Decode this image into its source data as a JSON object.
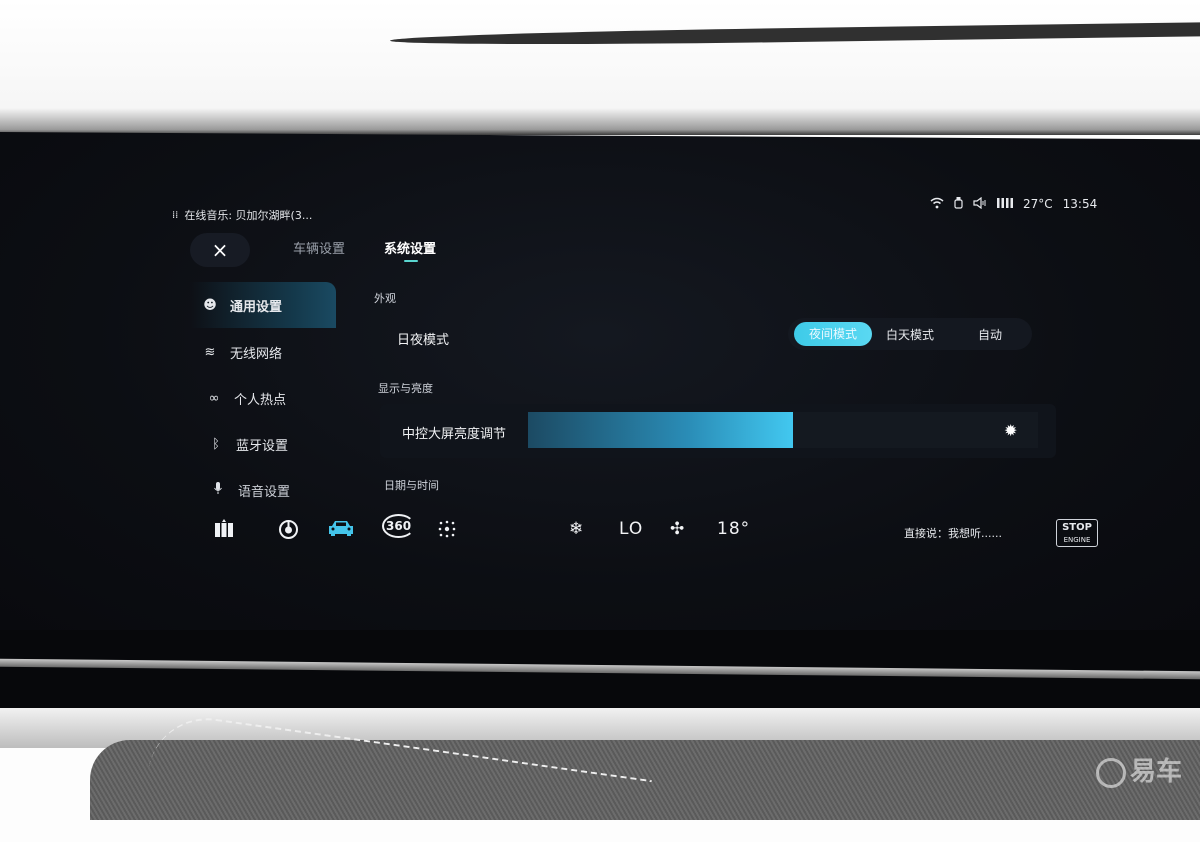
{
  "status_bar": {
    "now_playing": "在线音乐: 贝加尔湖畔(3...",
    "temperature": "27°C",
    "time": "13:54",
    "icons": [
      "music-bars-icon",
      "wifi-icon",
      "usb-icon",
      "volume-icon",
      "signal-icon"
    ]
  },
  "header": {
    "close_icon": "×",
    "tabs": [
      {
        "label": "车辆设置",
        "active": false
      },
      {
        "label": "系统设置",
        "active": true
      }
    ]
  },
  "sidebar": {
    "items": [
      {
        "label": "通用设置",
        "icon": "general-icon",
        "glyph": "☻",
        "active": true
      },
      {
        "label": "无线网络",
        "icon": "wifi-icon",
        "glyph": "≋",
        "active": false
      },
      {
        "label": "个人热点",
        "icon": "link-icon",
        "glyph": "∞",
        "active": false
      },
      {
        "label": "蓝牙设置",
        "icon": "bluetooth-icon",
        "glyph": "ᛒ",
        "active": false
      },
      {
        "label": "语音设置",
        "icon": "microphone-icon",
        "glyph": "🎙",
        "active": false
      }
    ]
  },
  "main": {
    "appearance": {
      "section_label": "外观",
      "day_night": {
        "label": "日夜模式",
        "options": [
          "夜间模式",
          "白天模式",
          "自动"
        ],
        "selected": "夜间模式"
      }
    },
    "display": {
      "section_label": "显示与亮度",
      "brightness": {
        "label": "中控大屏亮度调节",
        "value_percent": 52,
        "icon": "sun-icon"
      }
    },
    "datetime": {
      "section_label": "日期与时间"
    }
  },
  "dock": {
    "apps": [
      {
        "name": "apps-icon",
        "glyph": "▥"
      },
      {
        "name": "power-timer-icon",
        "glyph": "◍"
      },
      {
        "name": "car-icon",
        "glyph": "🚘",
        "active": true
      },
      {
        "name": "camera-360-icon",
        "glyph": "360"
      },
      {
        "name": "grid-dots-icon",
        "glyph": "⁙"
      }
    ],
    "climate": {
      "ac_icon": "❄",
      "left_temp": "LO",
      "fan_icon": "✣",
      "right_temp": "18°"
    },
    "voice_prompt": "直接说：我想听......",
    "stop_engine": {
      "line1": "STOP",
      "line2": "ENGINE"
    }
  },
  "watermark": "易车"
}
